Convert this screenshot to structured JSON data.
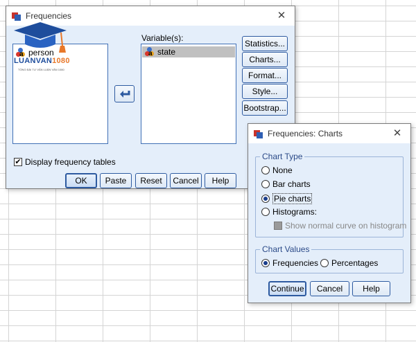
{
  "freq": {
    "title": "Frequencies",
    "variables_label": "Variable(s):",
    "source_vars": [
      "person"
    ],
    "selected_vars": [
      "state"
    ],
    "side_buttons": [
      "Statistics...",
      "Charts...",
      "Format...",
      "Style...",
      "Bootstrap..."
    ],
    "display_tables_label": "Display frequency tables",
    "display_tables_checked": true,
    "bottom_buttons": [
      "OK",
      "Paste",
      "Reset",
      "Cancel",
      "Help"
    ]
  },
  "charts": {
    "title": "Frequencies: Charts",
    "chart_type_label": "Chart Type",
    "chart_types": [
      {
        "label": "None",
        "selected": false
      },
      {
        "label": "Bar charts",
        "selected": false
      },
      {
        "label": "Pie charts",
        "selected": true
      },
      {
        "label": "Histograms:",
        "selected": false
      }
    ],
    "normal_curve_label": "Show normal curve on histogram",
    "chart_values_label": "Chart Values",
    "chart_values": [
      {
        "label": "Frequencies",
        "selected": true
      },
      {
        "label": "Percentages",
        "selected": false
      }
    ],
    "buttons": [
      "Continue",
      "Cancel",
      "Help"
    ]
  },
  "watermark": {
    "brand_part1": "LUANVAN",
    "brand_part2": "1080",
    "tagline": "TỔNG ĐÀI TƯ VẤN LUẬN VĂN 1080"
  },
  "colors": {
    "dialog_body": "#e4eefa",
    "accent_border": "#2d5aa0",
    "selected_row": "#c0c0c0"
  }
}
